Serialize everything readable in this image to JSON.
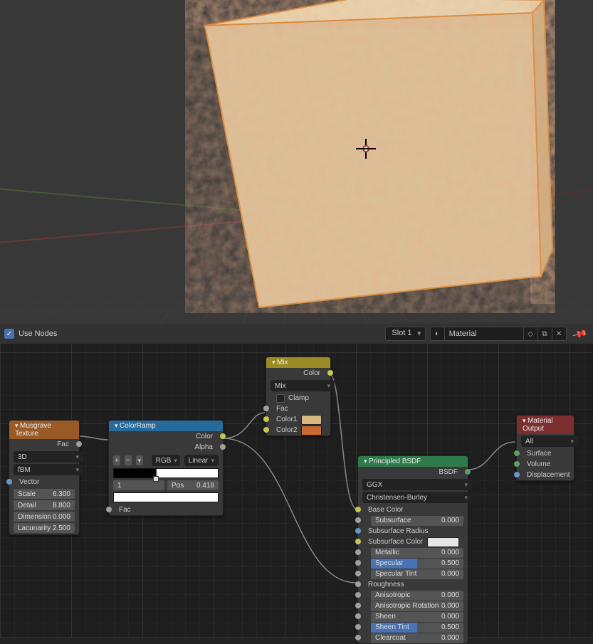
{
  "header": {
    "use_nodes_label": "Use Nodes",
    "slot_label": "Slot 1",
    "material_name": "Material"
  },
  "musgrave": {
    "title": "Musgrave Texture",
    "out_fac": "Fac",
    "dim": "3D",
    "type": "fBM",
    "vector": "Vector",
    "scale_l": "Scale",
    "scale_v": "6.300",
    "detail_l": "Detail",
    "detail_v": "8.800",
    "dimension_l": "Dimension",
    "dimension_v": "0.000",
    "lacunarity_l": "Lacunarity",
    "lacunarity_v": "2.500"
  },
  "colorramp": {
    "title": "ColorRamp",
    "out_color": "Color",
    "out_alpha": "Alpha",
    "mode": "RGB",
    "interp": "Linear",
    "idx_l": "1",
    "pos_l": "Pos",
    "pos_v": "0.418",
    "in_fac": "Fac"
  },
  "mix": {
    "title": "Mix",
    "out_color": "Color",
    "blend": "Mix",
    "clamp": "Clamp",
    "fac": "Fac",
    "color1": "Color1",
    "color2": "Color2"
  },
  "bsdf": {
    "title": "Principled BSDF",
    "out": "BSDF",
    "dist": "GGX",
    "sss": "Christensen-Burley",
    "p": {
      "base": "Base Color",
      "subsurf": "Subsurface",
      "subsurf_v": "0.000",
      "subsurf_r": "Subsurface Radius",
      "subsurf_c": "Subsurface Color",
      "metal": "Metallic",
      "metal_v": "0.000",
      "spec": "Specular",
      "spec_v": "0.500",
      "spectint": "Specular Tint",
      "spectint_v": "0.000",
      "rough": "Roughness",
      "aniso": "Anisotropic",
      "aniso_v": "0.000",
      "anisor": "Anisotropic Rotation",
      "anisor_v": "0.000",
      "sheen": "Sheen",
      "sheen_v": "0.000",
      "sheent": "Sheen Tint",
      "sheent_v": "0.500",
      "clear": "Clearcoat",
      "clear_v": "0.000"
    }
  },
  "output": {
    "title": "Material Output",
    "target": "All",
    "surface": "Surface",
    "volume": "Volume",
    "disp": "Displacement"
  }
}
